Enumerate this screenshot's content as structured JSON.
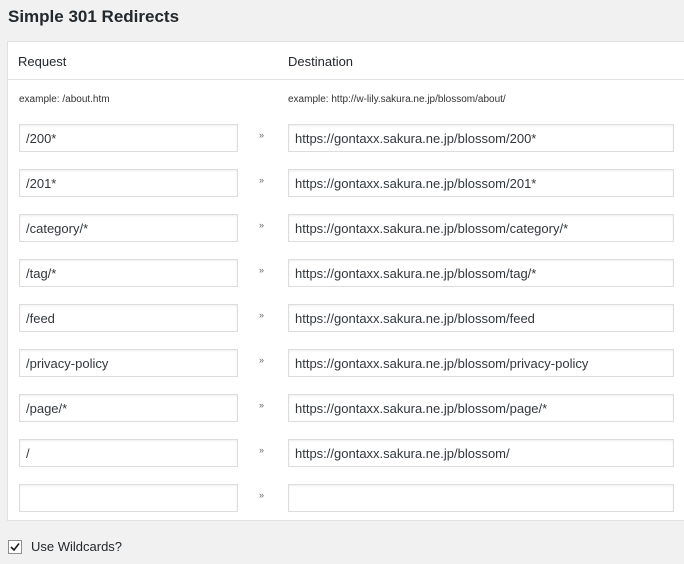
{
  "page": {
    "title": "Simple 301 Redirects"
  },
  "table": {
    "headers": {
      "request": "Request",
      "destination": "Destination"
    },
    "examples": {
      "request": "example: /about.htm",
      "destination": "example: http://w-lily.sakura.ne.jp/blossom/about/"
    },
    "arrow_glyph": "»",
    "rows": [
      {
        "request": "/200*",
        "destination": "https://gontaxx.sakura.ne.jp/blossom/200*"
      },
      {
        "request": "/201*",
        "destination": "https://gontaxx.sakura.ne.jp/blossom/201*"
      },
      {
        "request": "/category/*",
        "destination": "https://gontaxx.sakura.ne.jp/blossom/category/*"
      },
      {
        "request": "/tag/*",
        "destination": "https://gontaxx.sakura.ne.jp/blossom/tag/*"
      },
      {
        "request": "/feed",
        "destination": "https://gontaxx.sakura.ne.jp/blossom/feed"
      },
      {
        "request": "/privacy-policy",
        "destination": "https://gontaxx.sakura.ne.jp/blossom/privacy-policy"
      },
      {
        "request": "/page/*",
        "destination": "https://gontaxx.sakura.ne.jp/blossom/page/*"
      },
      {
        "request": "/",
        "destination": "https://gontaxx.sakura.ne.jp/blossom/"
      },
      {
        "request": "",
        "destination": ""
      }
    ]
  },
  "wildcards": {
    "label": "Use Wildcards?",
    "checked": true
  }
}
